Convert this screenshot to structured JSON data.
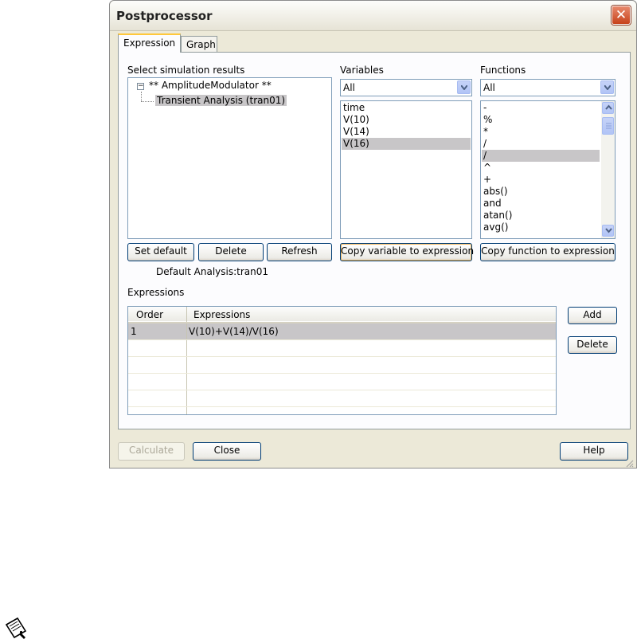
{
  "window": {
    "title": "Postprocessor"
  },
  "tabs": [
    {
      "label": "Expression"
    },
    {
      "label": "Graph"
    }
  ],
  "results": {
    "label": "Select simulation results",
    "tree_root": "** AmplitudeModulator **",
    "tree_child": "Transient Analysis (tran01)",
    "buttons": {
      "set_default": "Set default",
      "delete": "Delete",
      "refresh": "Refresh"
    },
    "default_analysis": "Default Analysis:tran01"
  },
  "variables": {
    "label": "Variables",
    "filter_value": "All",
    "items": [
      "time",
      "V(10)",
      "V(14)",
      "V(16)"
    ],
    "selected_index": 3,
    "copy_button": "Copy variable to expression"
  },
  "functions": {
    "label": "Functions",
    "filter_value": "All",
    "items": [
      "-",
      "%",
      "*",
      "/",
      "/",
      "^",
      "+",
      "abs()",
      "and",
      "atan()",
      "avg()"
    ],
    "selected_index": 4,
    "copy_button": "Copy function to expression"
  },
  "expressions": {
    "label": "Expressions",
    "columns": [
      "Order",
      "Expressions"
    ],
    "rows": [
      {
        "order": "1",
        "expression": "V(10)+V(14)/V(16)"
      }
    ],
    "buttons": {
      "add": "Add",
      "delete": "Delete"
    }
  },
  "footer": {
    "calculate": "Calculate",
    "close": "Close",
    "help": "Help"
  },
  "icons": {
    "close": "close-icon",
    "note": "note-icon"
  }
}
